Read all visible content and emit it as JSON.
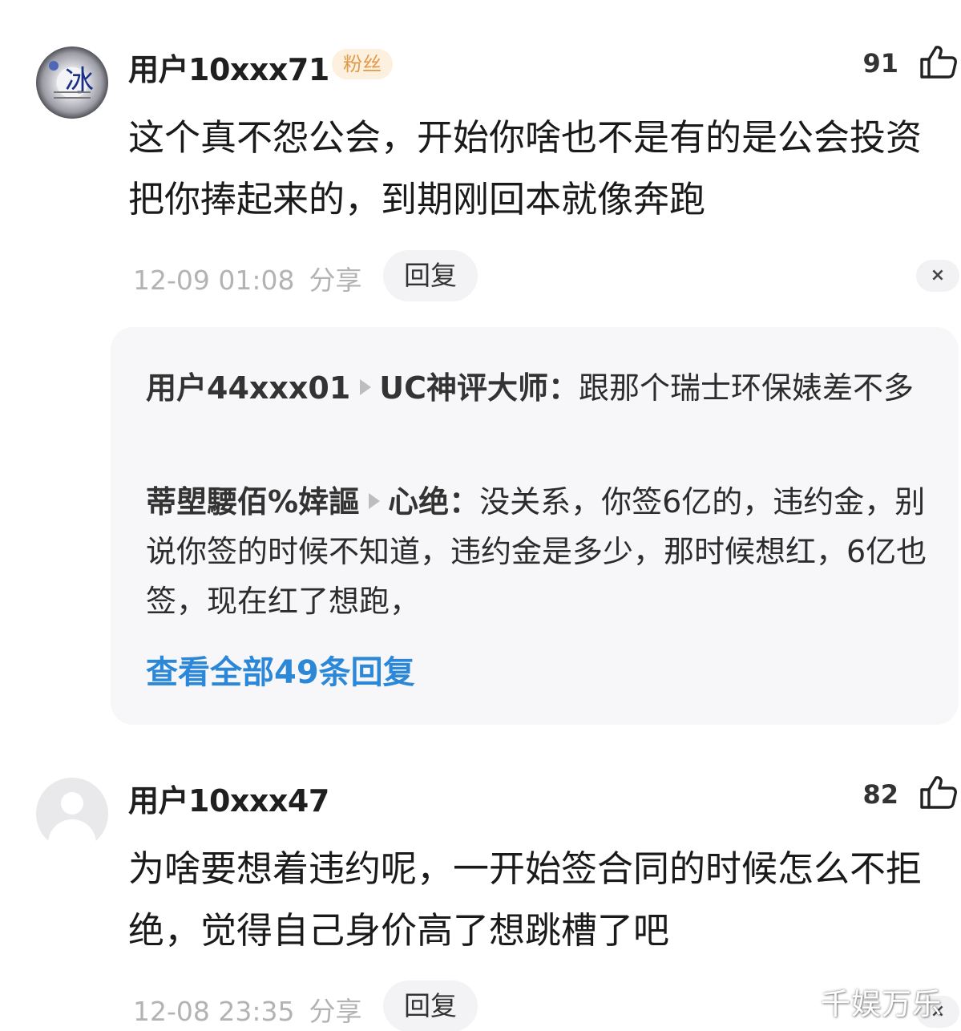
{
  "comments": [
    {
      "username": "用户10xxx71",
      "badge": "粉丝",
      "likes": "91",
      "text": "这个真不怨公会，开始你啥也不是有的是公会投资把你捧起来的，到期刚回本就像奔跑",
      "time": "12-09 01:08",
      "share_label": "分享",
      "reply_label": "回复",
      "close_label": "×",
      "avatar_glyph": "冰",
      "replies": [
        {
          "from": "用户44xxx01",
          "to": "UC神评大师：",
          "text": "跟那个瑞士环保婊差不多"
        },
        {
          "from": "蒂塱騕佰%婞謳",
          "to": "心绝：",
          "text": "没关系，你签6亿的，违约金，别说你签的时候不知道，违约金是多少，那时候想红，6亿也签，现在红了想跑，"
        }
      ],
      "view_all_label": "查看全部49条回复"
    },
    {
      "username": "用户10xxx47",
      "likes": "82",
      "text": "为啥要想着违约呢，一开始签合同的时候怎么不拒绝，觉得自己身价高了想跳槽了吧",
      "time": "12-08 23:35",
      "share_label": "分享",
      "reply_label": "回复",
      "close_label": "×"
    }
  ],
  "watermark": "千娱万乐",
  "colors": {
    "link": "#2b87d8",
    "badge_bg": "#fdf0de",
    "badge_text": "#e09a4a",
    "reply_box_bg": "#f7f7f9",
    "meta_text": "#b3b3b3"
  },
  "icons": {
    "like": "thumbs-up-icon",
    "close": "close-icon"
  }
}
